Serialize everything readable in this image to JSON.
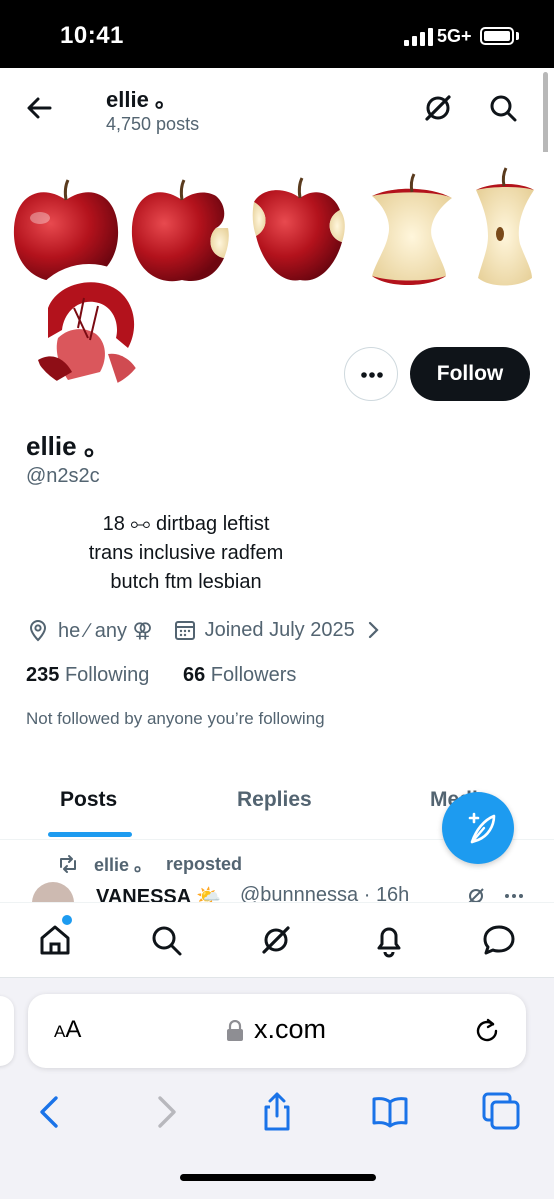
{
  "status_bar": {
    "time": "10:41",
    "network": "5G+"
  },
  "header": {
    "name": "ellie 。",
    "post_count": "4,750 posts"
  },
  "profile": {
    "display_name": "ellie 。",
    "handle": "@n2s2c",
    "bio_lines": [
      "18 ⧟ dirtbag leftist",
      "trans inclusive radfem",
      "butch ftm lesbian"
    ],
    "location": "he ∕ any ⚢",
    "joined": "Joined July 2025",
    "following_count": "235",
    "following_label": "Following",
    "followers_count": "66",
    "followers_label": "Followers",
    "not_followed_text": "Not followed by anyone you’re following",
    "follow_label": "Follow"
  },
  "tabs": [
    {
      "label": "Posts",
      "active": true
    },
    {
      "label": "Replies",
      "active": false
    },
    {
      "label": "Media",
      "active": false
    }
  ],
  "feed": {
    "repost_author": "ellie 。",
    "repost_label": "reposted",
    "post_author": "VANESSA 🌤️",
    "post_handle_time": "@bunnnessa · 16h"
  },
  "bottom_nav": [
    "home-icon",
    "search-icon",
    "grok-icon",
    "notifications-icon",
    "messages-icon"
  ],
  "browser": {
    "url": "x.com",
    "text_size_label": "AA"
  },
  "colors": {
    "accent": "#1d9bf0",
    "text": "#0f1419",
    "secondary": "#536471",
    "follow_button": "#0f1419",
    "apple_red": "#b3121c"
  }
}
